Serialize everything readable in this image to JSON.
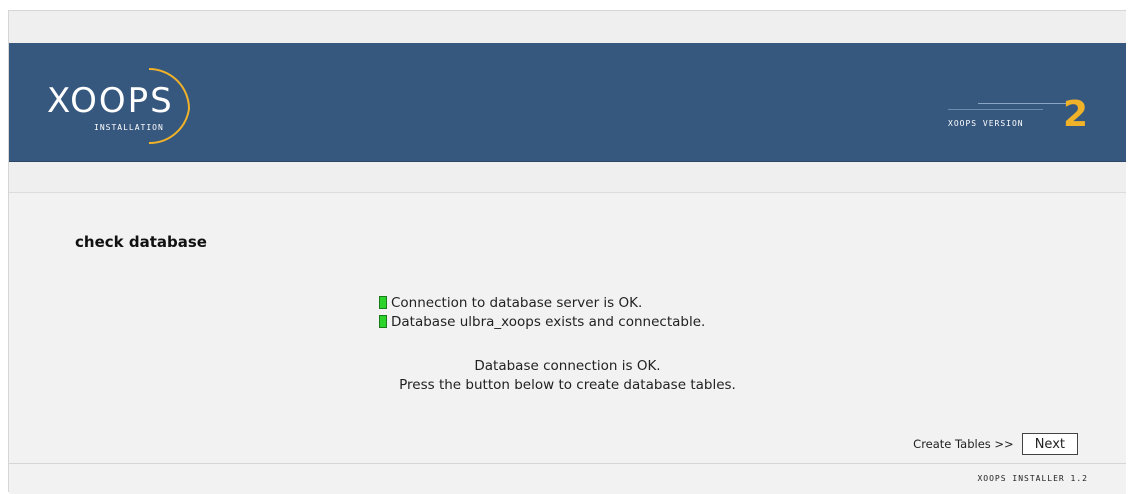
{
  "header": {
    "logo_text": "XOOPS",
    "logo_sub": "INSTALLATION",
    "version_label": "XOOPS VERSION",
    "version_number": "2"
  },
  "page": {
    "title": "check database"
  },
  "checks": [
    {
      "status": "ok",
      "text": "Connection to database server is OK."
    },
    {
      "status": "ok",
      "text": "Database ulbra_xoops exists and connectable."
    }
  ],
  "message": {
    "line1": "Database connection is OK.",
    "line2": "Press the button below to create database tables."
  },
  "actions": {
    "next_label_text": "Create Tables >>",
    "next_button": "Next"
  },
  "footer": {
    "text": "XOOPS INSTALLER 1.2"
  },
  "colors": {
    "header_bg": "#36577e",
    "ok_indicator": "#2bd32b",
    "accent": "#f0b228"
  }
}
